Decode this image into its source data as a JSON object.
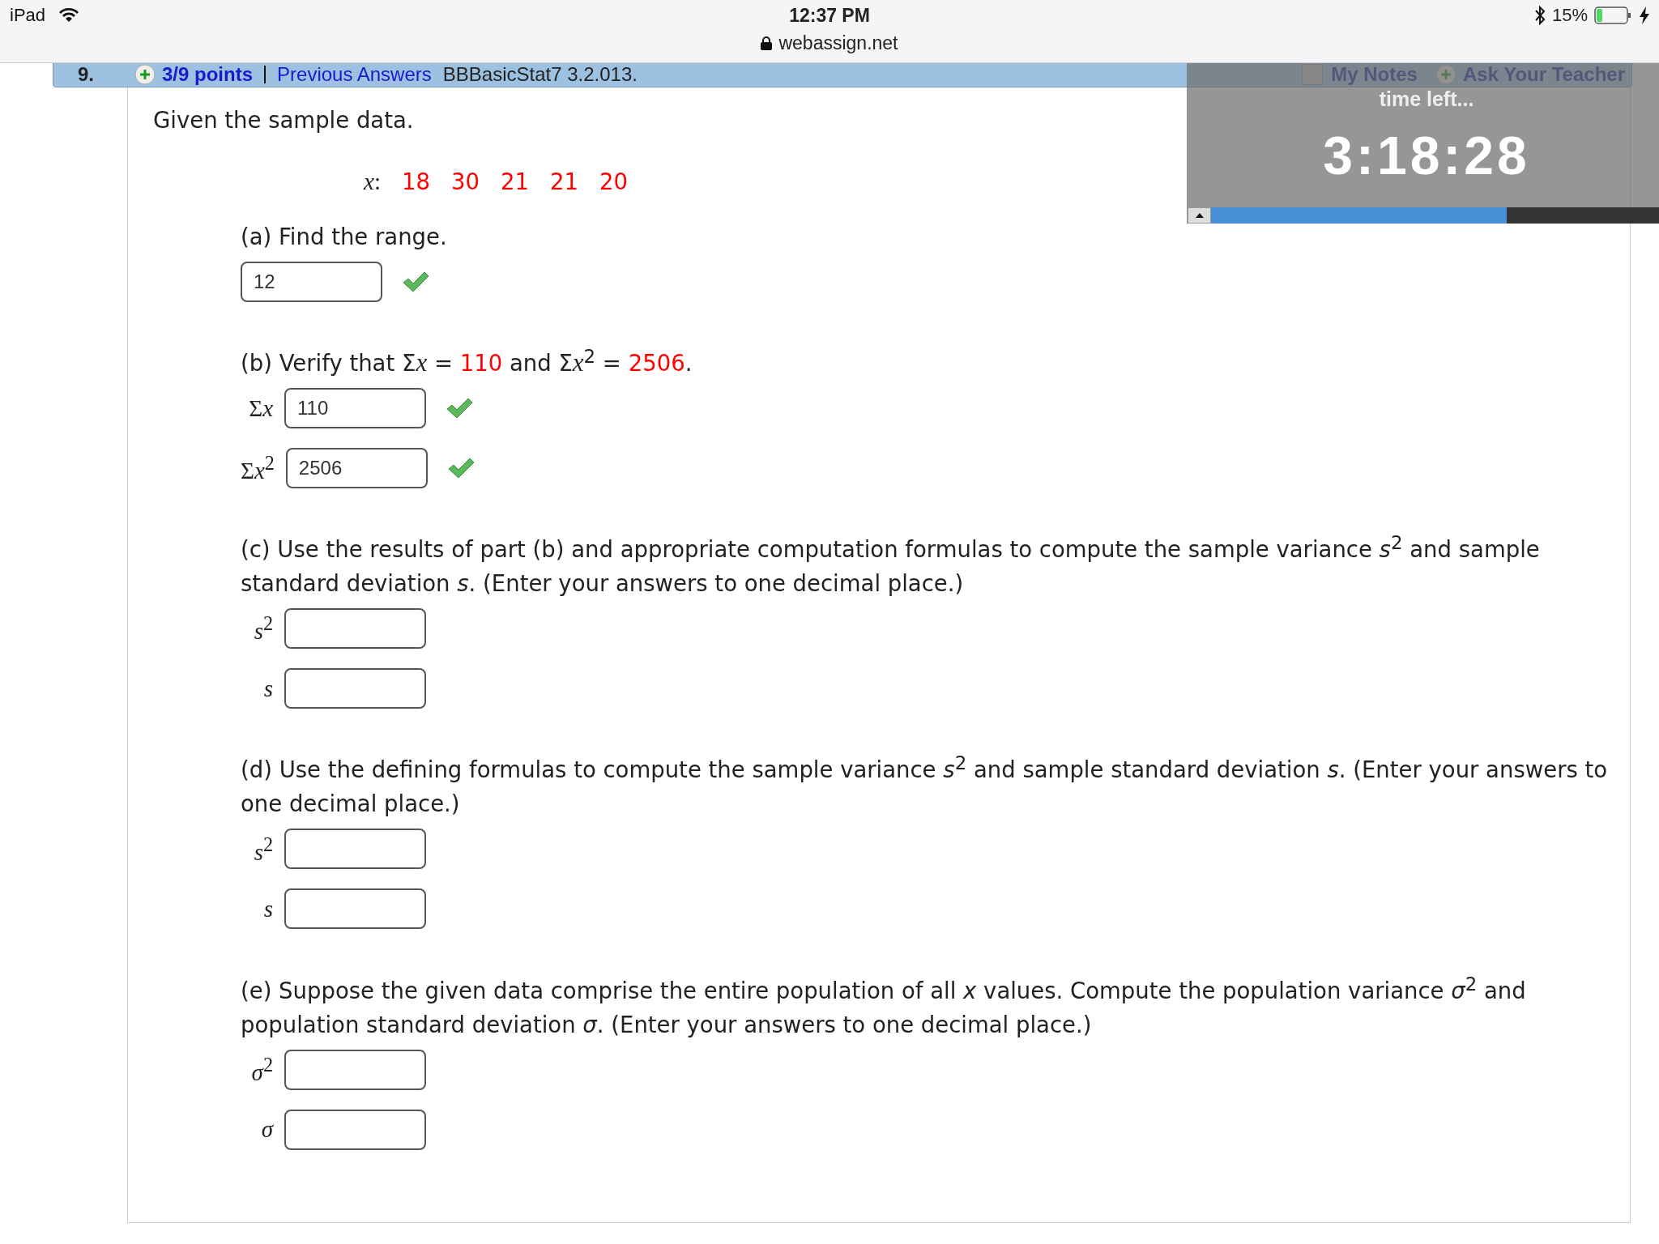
{
  "status_bar": {
    "device": "iPad",
    "time": "12:37 PM",
    "url": "webassign.net",
    "battery": "15%"
  },
  "question_header": {
    "number": "9.",
    "points": "3/9 points",
    "link": "Previous Answers",
    "source": "BBBasicStat7 3.2.013.",
    "notes_checked": false,
    "notes": "My Notes",
    "ask": "Ask Your Teacher"
  },
  "timer": {
    "label": "time left...",
    "time": "3:18:28",
    "level": 0.66
  },
  "intro": "Given the sample data.",
  "data": {
    "label": "*x*:",
    "values": [
      "18",
      "30",
      "21",
      "21",
      "20"
    ]
  },
  "parts": [
    {
      "prompt": [
        {
          "kind": "text",
          "text": "(a) Find the range."
        }
      ],
      "answers": [
        {
          "value": "12",
          "correct": true
        }
      ]
    },
    {
      "prompt": [
        {
          "kind": "text",
          "text": "(b) Verify that Σ"
        },
        {
          "kind": "var",
          "text": "x"
        },
        {
          "kind": "text",
          "text": " = "
        },
        {
          "kind": "value",
          "text": "110"
        },
        {
          "kind": "text",
          "text": " and Σ"
        },
        {
          "kind": "var",
          "text": "x"
        },
        {
          "kind": "text",
          "text": "$^{2}$ = "
        },
        {
          "kind": "value",
          "text": "2506"
        },
        {
          "kind": "text",
          "text": "."
        }
      ],
      "answers": [
        {
          "label": {
            "prefix": "Σ",
            "var": "x"
          },
          "value": "110",
          "correct": true
        },
        {
          "label": {
            "prefix": "Σ",
            "var": "x",
            "sup": "2"
          },
          "value": "2506",
          "correct": true
        }
      ]
    },
    {
      "prompt": [
        {
          "kind": "text",
          "text": "(c) Use the results of part (b) and appropriate computation formulas to compute the sample variance *s*$^{2}$ and sample standard deviation *s*. (Enter your answers to one decimal place.)"
        }
      ],
      "answers": [
        {
          "label": {
            "var": "s",
            "sup": "2"
          },
          "correct": false
        },
        {
          "label": {
            "var": "s"
          },
          "correct": false
        }
      ]
    },
    {
      "prompt": [
        {
          "kind": "text",
          "text": "(d) Use the defining formulas to compute the sample variance *s*$^{2}$ and sample standard deviation *s*. (Enter your answers to one decimal place.)"
        }
      ],
      "answers": [
        {
          "label": {
            "var": "s",
            "sup": "2"
          },
          "correct": false
        },
        {
          "label": {
            "var": "s"
          },
          "correct": false
        }
      ]
    },
    {
      "prompt": [
        {
          "kind": "text",
          "text": "(e) Suppose the given data comprise the entire population of all *x* values. Compute the population variance *σ*$^{2}$ and population standard deviation *σ*. (Enter your answers to one decimal place.)"
        }
      ],
      "answers": [
        {
          "label": {
            "var": "σ",
            "sup": "2"
          },
          "correct": false
        },
        {
          "label": {
            "var": "σ"
          },
          "correct": false
        }
      ]
    }
  ]
}
